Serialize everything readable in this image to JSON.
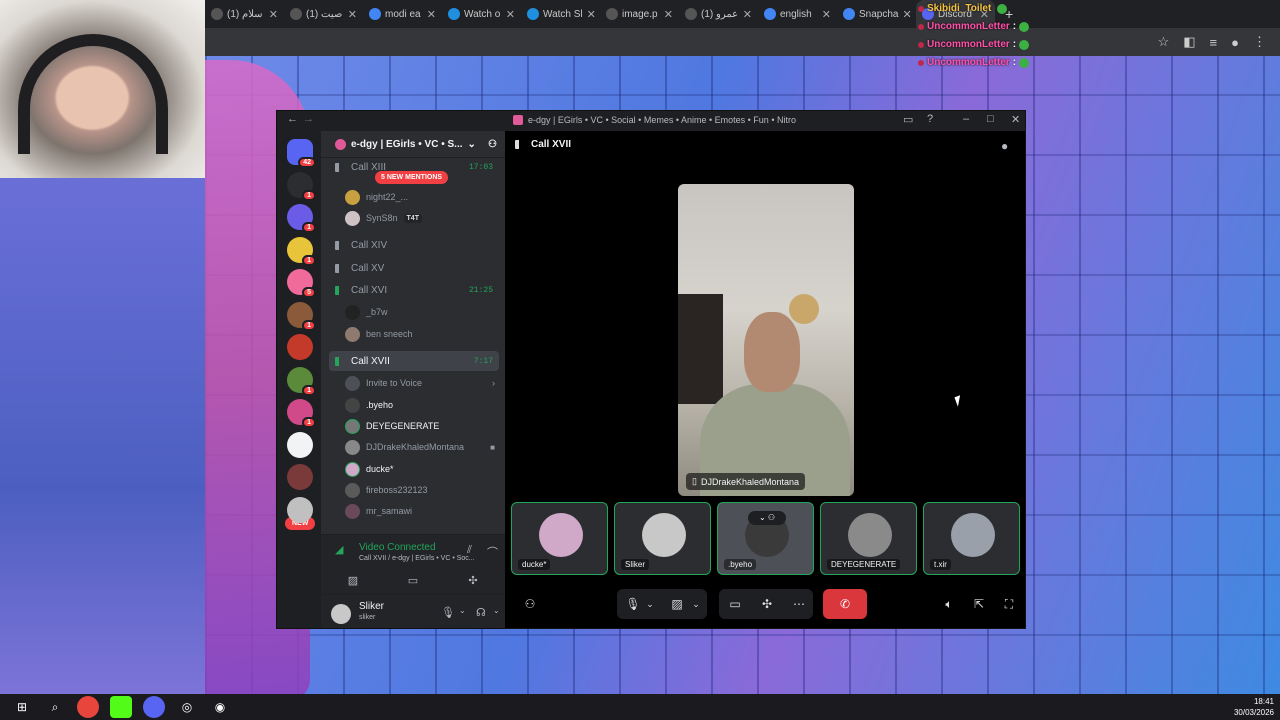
{
  "browser": {
    "tabs": [
      {
        "label": "سلام (1)",
        "icon": "x-icon"
      },
      {
        "label": "صيت (1)",
        "icon": "x-icon"
      },
      {
        "label": "modi ea",
        "icon": "google-icon"
      },
      {
        "label": "Watch o",
        "icon": "edge-icon"
      },
      {
        "label": "Watch Sl",
        "icon": "edge-icon"
      },
      {
        "label": "image.p",
        "icon": "page-icon"
      },
      {
        "label": "عمرو (1)",
        "icon": "x-icon"
      },
      {
        "label": "english",
        "icon": "google-icon"
      },
      {
        "label": "Snapcha",
        "icon": "google-icon"
      },
      {
        "label": "Discord",
        "icon": "discord-icon"
      }
    ],
    "close_glyph": "✕",
    "new_tab_glyph": "+"
  },
  "stream_chat": [
    {
      "user": "Skibidi_Toilet",
      "text": ""
    },
    {
      "user": "UncommonLetter",
      "text": ":"
    },
    {
      "user": "UncommonLetter",
      "text": ":"
    },
    {
      "user": "UncommonLetter",
      "text": ":"
    }
  ],
  "discord": {
    "window_title": "e-dgy | EGirls • VC • Social • Memes • Anime • Emotes • Fun • Nitro",
    "guild_name": "e-dgy | EGirls • VC • S...",
    "new_mentions": "5 NEW MENTIONS",
    "servers": [
      {
        "badge": "42"
      },
      {
        "badge": "1"
      },
      {
        "badge": "1"
      },
      {
        "badge": "1"
      },
      {
        "badge": "5"
      },
      {
        "badge": "1"
      },
      {
        "badge": ""
      },
      {
        "badge": "1"
      },
      {
        "badge": "1"
      },
      {
        "badge": ""
      },
      {
        "badge": ""
      },
      {
        "badge": ""
      }
    ],
    "new_pill": "NEW",
    "channels": {
      "call13": {
        "name": "Call XIII",
        "time": "17:03"
      },
      "members13": [
        {
          "name": "night22_..."
        },
        {
          "name": "SynS8n",
          "tag": "T4T"
        }
      ],
      "call14": "Call XIV",
      "call15": "Call XV",
      "call16": {
        "name": "Call XVI",
        "time": "21:25"
      },
      "members16": [
        "_b7w",
        "ben sneech"
      ],
      "call17": {
        "name": "Call XVII",
        "time": "7:17"
      },
      "invite": "Invite to Voice",
      "members17": [
        ".byeho",
        "DEYEGENERATE",
        "DJDrakeKhaledMontana",
        "ducke*",
        "fireboss232123",
        "mr_samawi"
      ]
    },
    "voice_panel": {
      "status": "Video Connected",
      "subtitle": "Call XVII / e-dgy | EGirls • VC • Soc..."
    },
    "user": {
      "name": "Sliker",
      "status": "sliker"
    },
    "stage": {
      "channel": "Call XVII",
      "main_video_name": "DJDrakeKhaledMontana",
      "tiles": [
        {
          "name": "ducke*",
          "color": "#d0a8c8"
        },
        {
          "name": "Sliker",
          "color": "#c8c8c8"
        },
        {
          "name": ".byeho",
          "color": "#3a3a3a"
        },
        {
          "name": "DEYEGENERATE",
          "color": "#8a8a8a"
        },
        {
          "name": "t.xir",
          "color": "#9aa0aa"
        }
      ]
    }
  },
  "taskbar": {
    "time": "18:41",
    "date": "30/03/2026"
  },
  "colors": {
    "accent_green": "#23a55a",
    "danger_red": "#da373c",
    "badge_red": "#f23f43"
  }
}
